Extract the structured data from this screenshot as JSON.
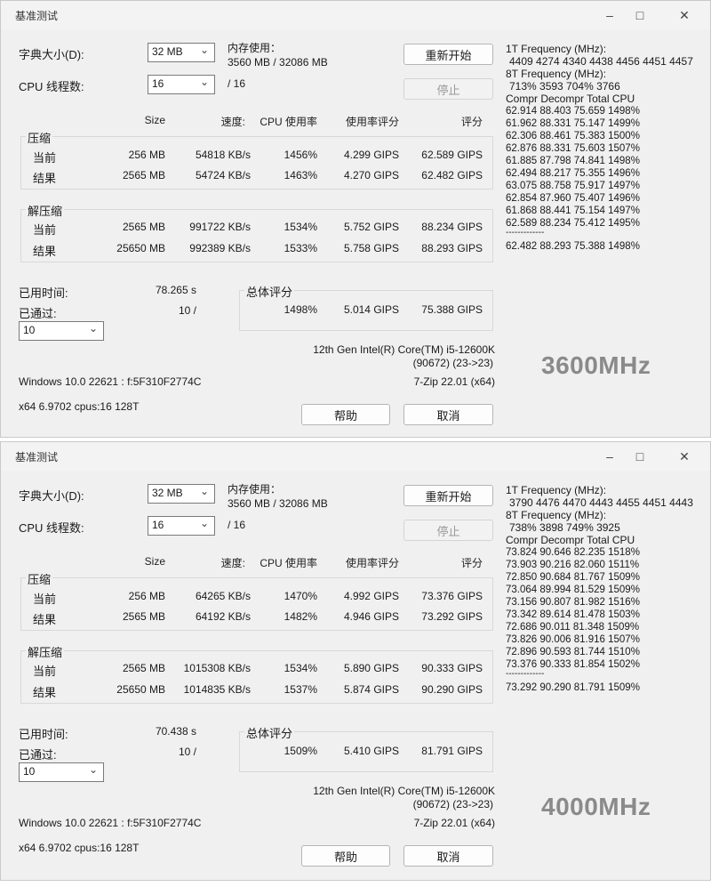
{
  "windows": [
    {
      "title": "基准测试",
      "dict_label": "字典大小(D):",
      "dict_value": "32 MB",
      "threads_label": "CPU 线程数:",
      "threads_value": "16",
      "threads_max": "/ 16",
      "mem_label": "内存使用：",
      "mem_value": "3560 MB / 32086 MB",
      "restart_button": "重新开始",
      "stop_button": "停止",
      "headers": {
        "size": "Size",
        "speed": "速度:",
        "cpu": "CPU 使用率",
        "rating": "使用率评分",
        "score": "评分"
      },
      "compress": {
        "label": "压缩",
        "current": {
          "label": "当前",
          "size": "256 MB",
          "speed": "54818 KB/s",
          "cpu": "1456%",
          "rating": "4.299 GIPS",
          "score": "62.589 GIPS"
        },
        "result": {
          "label": "结果",
          "size": "2565 MB",
          "speed": "54724 KB/s",
          "cpu": "1463%",
          "rating": "4.270 GIPS",
          "score": "62.482 GIPS"
        }
      },
      "decompress": {
        "label": "解压缩",
        "current": {
          "label": "当前",
          "size": "2565 MB",
          "speed": "991722 KB/s",
          "cpu": "1534%",
          "rating": "5.752 GIPS",
          "score": "88.234 GIPS"
        },
        "result": {
          "label": "结果",
          "size": "25650 MB",
          "speed": "992389 KB/s",
          "cpu": "1533%",
          "rating": "5.758 GIPS",
          "score": "88.293 GIPS"
        }
      },
      "elapsed_label": "已用时间:",
      "elapsed_value": "78.265 s",
      "passes_label": "已通过:",
      "passes_value": "10 /",
      "passes_combo": "10",
      "total_label": "总体评分",
      "total_cpu": "1498%",
      "total_rating": "5.014 GIPS",
      "total_score": "75.388 GIPS",
      "cpu_name": "12th Gen Intel(R) Core(TM) i5-12600K",
      "cpu_id": "(90672) (23->23)",
      "version": "7-Zip 22.01 (x64)",
      "os": "Windows 10.0 22621 : f:5F310F2774C",
      "sys": "x64 6.9702 cpus:16 128T",
      "help_button": "帮助",
      "cancel_button": "取消",
      "freq_1t_label": "1T Frequency (MHz):",
      "freq_1t_values": "4409 4274 4340 4438 4456 4451 4457",
      "freq_8t_label": "8T Frequency (MHz):",
      "freq_8t_values": "713% 3593 704% 3766",
      "log_header": "Compr Decompr Total   CPU",
      "log_rows": [
        "62.914  88.403  75.659  1498%",
        "61.962  88.331  75.147  1499%",
        "62.306  88.461  75.383  1500%",
        "62.876  88.331  75.603  1507%",
        "61.885  87.798  74.841  1498%",
        "62.494  88.217  75.355  1496%",
        "63.075  88.758  75.917  1497%",
        "62.854  87.960  75.407  1496%",
        "61.868  88.441  75.154  1497%",
        "62.589  88.234  75.412  1495%"
      ],
      "log_sep": "-------------",
      "log_total": "62.482  88.293  75.388  1498%",
      "freq_overlay": "3600MHz"
    },
    {
      "title": "基准测试",
      "dict_label": "字典大小(D):",
      "dict_value": "32 MB",
      "threads_label": "CPU 线程数:",
      "threads_value": "16",
      "threads_max": "/ 16",
      "mem_label": "内存使用：",
      "mem_value": "3560 MB / 32086 MB",
      "restart_button": "重新开始",
      "stop_button": "停止",
      "headers": {
        "size": "Size",
        "speed": "速度:",
        "cpu": "CPU 使用率",
        "rating": "使用率评分",
        "score": "评分"
      },
      "compress": {
        "label": "压缩",
        "current": {
          "label": "当前",
          "size": "256 MB",
          "speed": "64265 KB/s",
          "cpu": "1470%",
          "rating": "4.992 GIPS",
          "score": "73.376 GIPS"
        },
        "result": {
          "label": "结果",
          "size": "2565 MB",
          "speed": "64192 KB/s",
          "cpu": "1482%",
          "rating": "4.946 GIPS",
          "score": "73.292 GIPS"
        }
      },
      "decompress": {
        "label": "解压缩",
        "current": {
          "label": "当前",
          "size": "2565 MB",
          "speed": "1015308 KB/s",
          "cpu": "1534%",
          "rating": "5.890 GIPS",
          "score": "90.333 GIPS"
        },
        "result": {
          "label": "结果",
          "size": "25650 MB",
          "speed": "1014835 KB/s",
          "cpu": "1537%",
          "rating": "5.874 GIPS",
          "score": "90.290 GIPS"
        }
      },
      "elapsed_label": "已用时间:",
      "elapsed_value": "70.438 s",
      "passes_label": "已通过:",
      "passes_value": "10 /",
      "passes_combo": "10",
      "total_label": "总体评分",
      "total_cpu": "1509%",
      "total_rating": "5.410 GIPS",
      "total_score": "81.791 GIPS",
      "cpu_name": "12th Gen Intel(R) Core(TM) i5-12600K",
      "cpu_id": "(90672) (23->23)",
      "version": "7-Zip 22.01 (x64)",
      "os": "Windows 10.0 22621 : f:5F310F2774C",
      "sys": "x64 6.9702 cpus:16 128T",
      "help_button": "帮助",
      "cancel_button": "取消",
      "freq_1t_label": "1T Frequency (MHz):",
      "freq_1t_values": "3790 4476 4470 4443 4455 4451 4443",
      "freq_8t_label": "8T Frequency (MHz):",
      "freq_8t_values": "738% 3898 749% 3925",
      "log_header": "Compr Decompr Total   CPU",
      "log_rows": [
        "73.824  90.646  82.235  1518%",
        "73.903  90.216  82.060  1511%",
        "72.850  90.684  81.767  1509%",
        "73.064  89.994  81.529  1509%",
        "73.156  90.807  81.982  1516%",
        "73.342  89.614  81.478  1503%",
        "72.686  90.011  81.348  1509%",
        "73.826  90.006  81.916  1507%",
        "72.896  90.593  81.744  1510%",
        "73.376  90.333  81.854  1502%"
      ],
      "log_sep": "-------------",
      "log_total": "73.292  90.290  81.791  1509%",
      "freq_overlay": "4000MHz"
    }
  ]
}
